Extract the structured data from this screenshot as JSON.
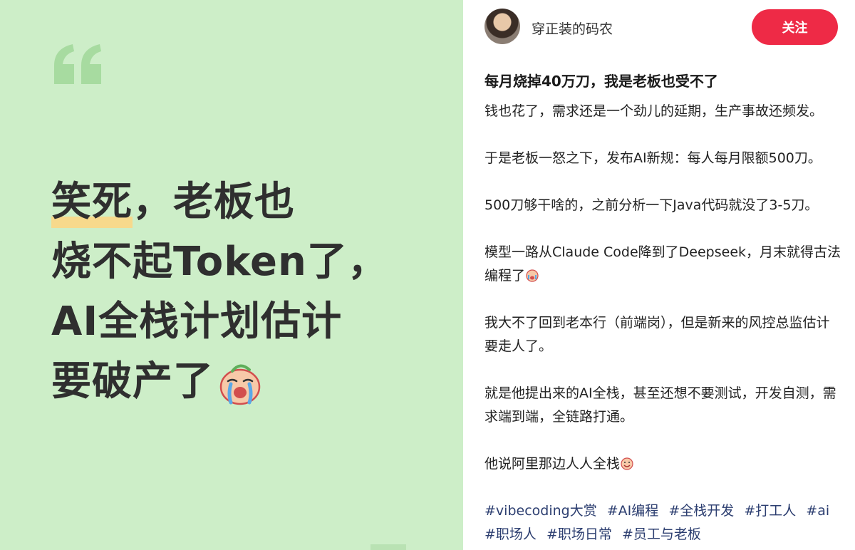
{
  "left_card": {
    "headline_highlight": "笑死",
    "headline_line1_rest": "，老板也",
    "headline_line2": "烧不起Token了，",
    "headline_line3": "AI全栈计划估计",
    "headline_line4": "要破产了",
    "emoji_icon": "crying-face-icon",
    "colors": {
      "background": "#cdeec8",
      "quote_mark": "#a7dba0",
      "highlight": "#f7d98c"
    }
  },
  "post": {
    "author_name": "穿正装的码农",
    "follow_label": "关注",
    "title": "每月烧掉40万刀，我是老板也受不了",
    "paragraphs": [
      "钱也花了，需求还是一个劲儿的延期，生产事故还频发。",
      "于是老板一怒之下，发布AI新规：每人每月限额500刀。",
      "500刀够干啥的，之前分析一下Java代码就没了3-5刀。",
      "模型一路从Claude Code降到了Deepseek，月末就得古法编程了",
      "我大不了回到老本行（前端岗），但是新来的风控总监估计要走人了。",
      "就是他提出来的AI全栈，甚至还想不要测试，开发自测，需求端到端，全链路打通。",
      "他说阿里那边人人全栈"
    ],
    "hashtags": [
      "#vibecoding大赏",
      "#AI编程",
      "#全栈开发",
      "#打工人",
      "#ai",
      "#职场人",
      "#职场日常",
      "#员工与老板"
    ],
    "colors": {
      "follow_button": "#ee2a46",
      "hashtag": "#2c3e70"
    }
  }
}
